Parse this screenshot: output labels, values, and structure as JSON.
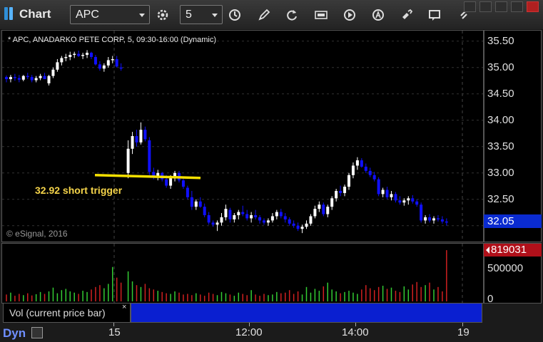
{
  "app": {
    "title": "Chart"
  },
  "toolbar": {
    "symbol": "APC",
    "interval": "5",
    "icons": [
      "settings-icon",
      "clock-icon",
      "pencil-draw-icon",
      "refresh-icon",
      "get-data-icon",
      "play-icon",
      "alert-icon",
      "tools-icon",
      "comment-icon",
      "link-icon"
    ]
  },
  "chart": {
    "header": "* APC, ANADARKO PETE CORP, 5, 09:30-16:00 (Dynamic)",
    "copyright": "© eSignal, 2016",
    "annotation": "32.92 short trigger",
    "last_price": "32.05",
    "price_ticks": [
      "35.50",
      "35.00",
      "34.50",
      "34.00",
      "33.50",
      "33.00",
      "32.50",
      "32.00"
    ],
    "colors": {
      "up": "#ffffff",
      "down": "#1010ff",
      "trigger_line": "#f5e000",
      "vol_up": "#33cc33",
      "vol_down": "#d02020"
    }
  },
  "volume": {
    "legend": "Vol (current price bar)",
    "close_symbol": "×",
    "last_value": "819031",
    "ticks": [
      "500000",
      "0"
    ]
  },
  "time_axis": {
    "mode": "Dyn",
    "labels": [
      "15",
      "12:00",
      "14:00",
      "19"
    ]
  },
  "chart_data": {
    "type": "candlestick",
    "ylim": [
      31.7,
      35.7
    ],
    "trigger_level": 32.92,
    "candles": [
      [
        34.82,
        34.85,
        34.72,
        34.78
      ],
      [
        34.78,
        34.86,
        34.72,
        34.82
      ],
      [
        34.82,
        34.88,
        34.75,
        34.8
      ],
      [
        34.8,
        34.86,
        34.72,
        34.77
      ],
      [
        34.77,
        34.86,
        34.74,
        34.84
      ],
      [
        34.84,
        34.9,
        34.78,
        34.82
      ],
      [
        34.82,
        34.86,
        34.72,
        34.76
      ],
      [
        34.76,
        34.84,
        34.72,
        34.8
      ],
      [
        34.8,
        34.88,
        34.76,
        34.84
      ],
      [
        34.84,
        34.9,
        34.78,
        34.78
      ],
      [
        34.7,
        34.86,
        34.66,
        34.84
      ],
      [
        34.84,
        35.0,
        34.8,
        34.96
      ],
      [
        34.96,
        35.16,
        34.92,
        35.1
      ],
      [
        35.1,
        35.22,
        35.04,
        35.18
      ],
      [
        35.18,
        35.26,
        35.12,
        35.2
      ],
      [
        35.2,
        35.3,
        35.14,
        35.24
      ],
      [
        35.24,
        35.3,
        35.18,
        35.26
      ],
      [
        35.26,
        35.32,
        35.2,
        35.22
      ],
      [
        35.22,
        35.28,
        35.16,
        35.24
      ],
      [
        35.24,
        35.33,
        35.18,
        35.28
      ],
      [
        35.28,
        35.3,
        35.16,
        35.2
      ],
      [
        35.2,
        35.24,
        35.04,
        35.06
      ],
      [
        35.06,
        35.12,
        34.94,
        34.98
      ],
      [
        34.98,
        35.08,
        34.92,
        35.04
      ],
      [
        35.04,
        35.2,
        35.0,
        35.14
      ],
      [
        35.14,
        35.22,
        35.08,
        35.16
      ],
      [
        35.16,
        35.22,
        35.0,
        35.02
      ],
      [
        35.0,
        35.08,
        34.94,
        34.98
      ],
      [
        33.0,
        33.62,
        32.9,
        33.46
      ],
      [
        33.46,
        33.78,
        33.36,
        33.7
      ],
      [
        33.7,
        33.82,
        33.5,
        33.58
      ],
      [
        33.58,
        33.96,
        33.54,
        33.82
      ],
      [
        33.82,
        33.88,
        33.6,
        33.64
      ],
      [
        33.62,
        33.68,
        32.96,
        33.02
      ],
      [
        33.02,
        33.1,
        32.88,
        32.94
      ],
      [
        32.94,
        33.06,
        32.86,
        33.0
      ],
      [
        33.0,
        33.02,
        32.84,
        32.88
      ],
      [
        32.88,
        32.96,
        32.72,
        32.76
      ],
      [
        32.76,
        32.96,
        32.7,
        32.9
      ],
      [
        32.9,
        33.04,
        32.84,
        33.0
      ],
      [
        33.0,
        33.04,
        32.82,
        32.86
      ],
      [
        32.86,
        32.9,
        32.7,
        32.74
      ],
      [
        32.72,
        32.76,
        32.5,
        32.54
      ],
      [
        32.54,
        32.66,
        32.3,
        32.36
      ],
      [
        32.36,
        32.5,
        32.3,
        32.46
      ],
      [
        32.46,
        32.54,
        32.34,
        32.36
      ],
      [
        32.36,
        32.42,
        32.16,
        32.2
      ],
      [
        32.2,
        32.26,
        32.02,
        32.06
      ],
      [
        32.06,
        32.1,
        31.98,
        32.02
      ],
      [
        32.02,
        32.1,
        31.9,
        32.06
      ],
      [
        32.06,
        32.24,
        32.0,
        32.16
      ],
      [
        32.16,
        32.4,
        32.1,
        32.32
      ],
      [
        32.3,
        32.34,
        32.06,
        32.12
      ],
      [
        32.12,
        32.24,
        32.06,
        32.2
      ],
      [
        32.2,
        32.3,
        32.12,
        32.26
      ],
      [
        32.26,
        32.38,
        32.18,
        32.22
      ],
      [
        32.22,
        32.3,
        32.1,
        32.14
      ],
      [
        32.14,
        32.26,
        32.06,
        32.2
      ],
      [
        32.2,
        32.3,
        32.12,
        32.16
      ],
      [
        32.16,
        32.2,
        32.04,
        32.1
      ],
      [
        32.1,
        32.14,
        32.02,
        32.06
      ],
      [
        32.06,
        32.14,
        32.0,
        32.1
      ],
      [
        32.1,
        32.24,
        32.06,
        32.18
      ],
      [
        32.18,
        32.3,
        32.12,
        32.26
      ],
      [
        32.26,
        32.32,
        32.14,
        32.18
      ],
      [
        32.18,
        32.24,
        32.06,
        32.12
      ],
      [
        32.12,
        32.16,
        32.0,
        32.04
      ],
      [
        32.04,
        32.1,
        31.96,
        32.0
      ],
      [
        32.0,
        32.06,
        31.9,
        31.94
      ],
      [
        31.94,
        32.02,
        31.86,
        31.98
      ],
      [
        31.98,
        32.1,
        31.94,
        32.04
      ],
      [
        32.04,
        32.22,
        32.0,
        32.18
      ],
      [
        32.18,
        32.38,
        32.14,
        32.32
      ],
      [
        32.32,
        32.46,
        32.26,
        32.4
      ],
      [
        32.4,
        32.44,
        32.18,
        32.22
      ],
      [
        32.22,
        32.4,
        32.16,
        32.36
      ],
      [
        32.36,
        32.56,
        32.3,
        32.52
      ],
      [
        32.52,
        32.7,
        32.46,
        32.66
      ],
      [
        32.66,
        32.76,
        32.56,
        32.62
      ],
      [
        32.62,
        32.78,
        32.56,
        32.74
      ],
      [
        32.74,
        33.0,
        32.68,
        32.96
      ],
      [
        32.96,
        33.2,
        32.9,
        33.14
      ],
      [
        33.14,
        33.3,
        33.06,
        33.24
      ],
      [
        33.24,
        33.28,
        33.1,
        33.12
      ],
      [
        33.12,
        33.18,
        33.0,
        33.04
      ],
      [
        33.04,
        33.1,
        32.92,
        32.96
      ],
      [
        32.96,
        33.02,
        32.84,
        32.88
      ],
      [
        32.88,
        32.92,
        32.56,
        32.6
      ],
      [
        32.6,
        32.72,
        32.54,
        32.68
      ],
      [
        32.68,
        32.74,
        32.5,
        32.54
      ],
      [
        32.54,
        32.66,
        32.48,
        32.6
      ],
      [
        32.6,
        32.64,
        32.44,
        32.48
      ],
      [
        32.48,
        32.56,
        32.4,
        32.44
      ],
      [
        32.44,
        32.52,
        32.38,
        32.48
      ],
      [
        32.48,
        32.56,
        32.4,
        32.52
      ],
      [
        32.52,
        32.58,
        32.42,
        32.46
      ],
      [
        32.46,
        32.5,
        32.36,
        32.4
      ],
      [
        32.4,
        32.44,
        32.06,
        32.1
      ],
      [
        32.1,
        32.2,
        32.04,
        32.16
      ],
      [
        32.16,
        32.22,
        32.06,
        32.1
      ],
      [
        32.1,
        32.18,
        32.04,
        32.14
      ],
      [
        32.14,
        32.2,
        32.08,
        32.12
      ],
      [
        32.12,
        32.18,
        32.04,
        32.08
      ],
      [
        32.08,
        32.14,
        32.0,
        32.06
      ]
    ],
    "volume": [
      110000,
      140000,
      90000,
      120000,
      100000,
      130000,
      95000,
      115000,
      150000,
      120000,
      160000,
      220000,
      130000,
      180000,
      200000,
      160000,
      140000,
      120000,
      170000,
      150000,
      190000,
      230000,
      260000,
      210000,
      280000,
      550000,
      380000,
      300000,
      480000,
      320000,
      260000,
      230000,
      280000,
      210000,
      190000,
      170000,
      150000,
      130000,
      120000,
      160000,
      140000,
      110000,
      120000,
      100000,
      130000,
      110000,
      90000,
      140000,
      120000,
      100000,
      150000,
      130000,
      110000,
      90000,
      140000,
      120000,
      100000,
      180000,
      110000,
      90000,
      120000,
      100000,
      110000,
      150000,
      130000,
      140000,
      180000,
      120000,
      160000,
      110000,
      230000,
      140000,
      200000,
      170000,
      240000,
      300000,
      190000,
      160000,
      130000,
      150000,
      170000,
      140000,
      120000,
      190000,
      260000,
      210000,
      180000,
      230000,
      250000,
      200000,
      220000,
      170000,
      150000,
      240000,
      190000,
      270000,
      310000,
      230000,
      260000,
      300000,
      190000,
      230000,
      160000,
      819031
    ],
    "session_marks": [
      "15",
      "12:00",
      "14:00",
      "19"
    ]
  }
}
